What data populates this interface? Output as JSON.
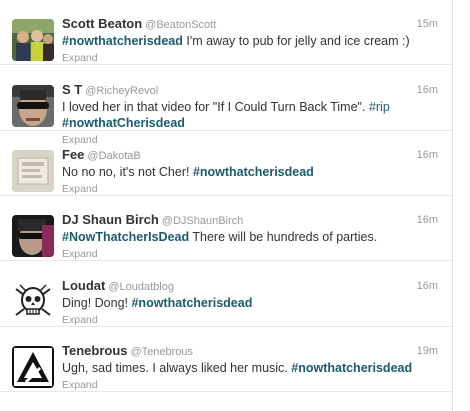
{
  "tweets": [
    {
      "fullname": "Scott Beaton",
      "username": "@BeatonScott",
      "time": "15m",
      "text_pre": "",
      "hashtag": "#nowthatcherisdead",
      "text_post": " I'm away to pub for jelly and ice cream :)",
      "expand": "Expand",
      "avatar_icon": "photo-group-avatar"
    },
    {
      "fullname": "S T",
      "username": "@RicheyRevol",
      "time": "16m",
      "line1": "I loved her in that video for \"If I Could Turn Back Time\". ",
      "hashtag_inline": "#rip",
      "hashtag": "#nowthatCherisdead",
      "expand": "Expand",
      "avatar_icon": "sunglasses-avatar"
    },
    {
      "fullname": "Fee",
      "username": "@DakotaB",
      "time": "16m",
      "text_pre": "No no no, it's not Cher! ",
      "hashtag": "#nowthatcherisdead",
      "text_post": "",
      "expand": "Expand",
      "avatar_icon": "box-photo-avatar"
    },
    {
      "fullname": "DJ Shaun Birch",
      "username": "@DJShaunBirch",
      "time": "16m",
      "text_pre": "",
      "hashtag": "#NowThatcherIsDead",
      "text_post": " There will be hundreds of parties.",
      "expand": "Expand",
      "avatar_icon": "dj-face-avatar"
    },
    {
      "fullname": "Loudat",
      "username": "@Loudatblog",
      "time": "16m",
      "text_pre": "Ding! Dong! ",
      "hashtag": "#nowthatcherisdead",
      "text_post": "",
      "expand": "Expand",
      "avatar_icon": "skull-logo-avatar"
    },
    {
      "fullname": "Tenebrous",
      "username": "@Tenebrous",
      "time": "19m",
      "text_pre": "Ugh, sad times. I always liked her music. ",
      "hashtag": "#nowthatcherisdead",
      "text_post": "",
      "expand": "Expand",
      "avatar_icon": "triangle-logo-avatar"
    }
  ]
}
